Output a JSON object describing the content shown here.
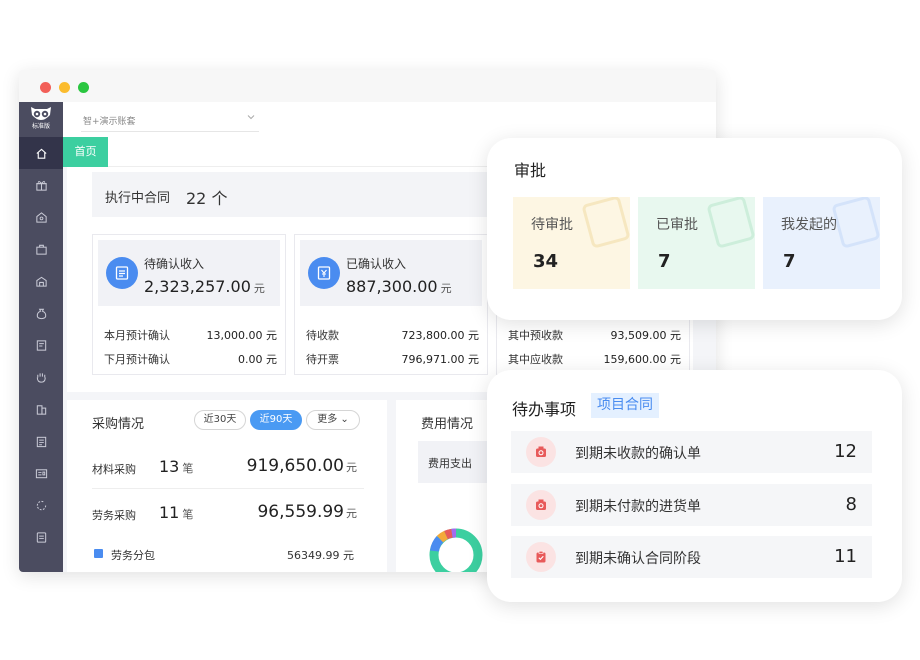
{
  "sidebar": {
    "version_label": "标准版"
  },
  "header": {
    "account": "智+演示账套"
  },
  "tabs": {
    "home": "首页"
  },
  "contracts": {
    "label": "执行中合同",
    "count": "22 个"
  },
  "stats": [
    {
      "title": "待确认收入",
      "amount": "2,323,257.00",
      "unit": "元",
      "rows": [
        {
          "label": "本月预计确认",
          "value": "13,000.00 元"
        },
        {
          "label": "下月预计确认",
          "value": "0.00 元"
        }
      ]
    },
    {
      "title": "已确认收入",
      "amount": "887,300.00",
      "unit": "元",
      "rows": [
        {
          "label": "待收款",
          "value": "723,800.00 元"
        },
        {
          "label": "待开票",
          "value": "796,971.00 元"
        }
      ]
    },
    {
      "title": "",
      "amount": "",
      "unit": "",
      "rows": [
        {
          "label": "其中预收款",
          "value": "93,509.00 元"
        },
        {
          "label": "其中应收款",
          "value": "159,600.00 元"
        }
      ]
    }
  ],
  "purchase": {
    "title": "采购情况",
    "filters": {
      "d30": "近30天",
      "d90": "近90天",
      "more": "更多"
    },
    "rows": [
      {
        "label": "材料采购",
        "count": "13",
        "count_unit": "笔",
        "amount": "919,650.00",
        "amount_unit": "元"
      },
      {
        "label": "劳务采购",
        "count": "11",
        "count_unit": "笔",
        "amount": "96,559.99",
        "amount_unit": "元"
      }
    ],
    "legend": {
      "label": "劳务分包",
      "value": "56349.99 元"
    }
  },
  "cost": {
    "title": "费用情况",
    "expense": "费用支出"
  },
  "approval": {
    "title": "审批",
    "boxes": [
      {
        "label": "待审批",
        "count": "34",
        "bg": "#fdf6e3"
      },
      {
        "label": "已审批",
        "count": "7",
        "bg": "#e8f8ef"
      },
      {
        "label": "我发起的",
        "count": "7",
        "bg": "#e9f1fd"
      }
    ]
  },
  "todo": {
    "title": "待办事项",
    "badge": "项目合同",
    "items": [
      {
        "label": "到期未收款的确认单",
        "count": "12"
      },
      {
        "label": "到期未付款的进货单",
        "count": "8"
      },
      {
        "label": "到期未确认合同阶段",
        "count": "11"
      }
    ]
  },
  "colors": {
    "accent": "#3ccfa0",
    "primary": "#4a8cf0",
    "sidebar": "#4b4c60",
    "alert": "#e85a5a"
  }
}
